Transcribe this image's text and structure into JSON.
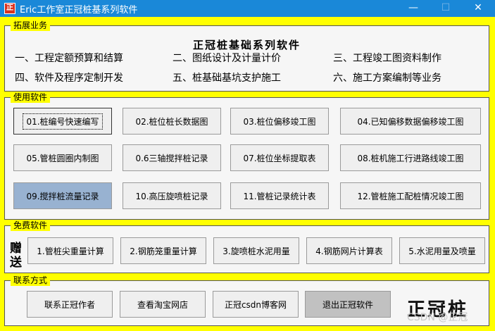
{
  "window": {
    "title": "Eric工作室正冠桩基系列软件",
    "icon_text": "正",
    "minimize_icon": "—",
    "maximize_icon": "☐",
    "close_icon": "✕"
  },
  "sections": {
    "business": {
      "title": "拓展业务",
      "headline": "正冠桩基础系列软件",
      "items": [
        "一、工程定额预算和结算",
        "二、图纸设计及计量计价",
        "三、工程竣工图资料制作",
        "四、软件及程序定制开发",
        "五、桩基础基坑支护施工",
        "六、施工方案编制等业务"
      ]
    },
    "software": {
      "title": "使用软件",
      "buttons": [
        "01.桩编号快速编写",
        "02.桩位桩长数据图",
        "03.桩位偏移竣工图",
        "04.已知偏移数据偏移竣工图",
        "05.管桩圆圈内制图",
        "0.6三轴搅拌桩记录",
        "07.桩位坐标提取表",
        "08.桩机施工行进路线竣工图",
        "09.搅拌桩流量记录",
        "10.高压旋喷桩记录",
        "11.管桩记录统计表",
        "12.管桩施工配桩情况竣工图"
      ]
    },
    "free": {
      "title": "免费软件",
      "gift_label": "赠送",
      "buttons": [
        "1.管桩尖重量计算",
        "2.钢筋笼重量计算",
        "3.旋喷桩水泥用量",
        "4.钢筋网片计算表",
        "5.水泥用量及喷量"
      ]
    },
    "contact": {
      "title": "联系方式",
      "buttons": [
        "联系正冠作者",
        "查看淘宝网店",
        "正冠csdn博客网",
        "退出正冠软件"
      ],
      "logo_text": "正冠桩"
    }
  },
  "watermark": "CSDN @正冠"
}
